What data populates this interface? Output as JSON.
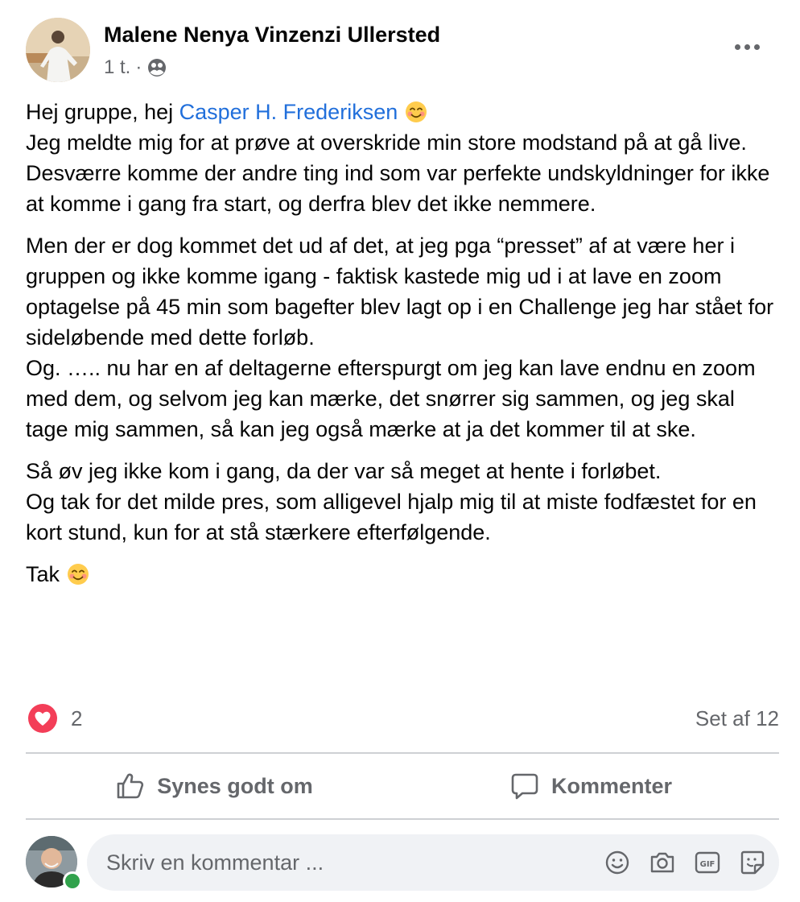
{
  "post": {
    "author_name": "Malene Nenya Vinzenzi Ullersted",
    "time": "1 t.",
    "separator": "·",
    "audience_icon": "group-icon",
    "paragraphs": [
      {
        "greeting_prefix": "Hej gruppe, hej ",
        "mention": "Casper H. Frederiksen",
        "emoji": "smiling-face-icon",
        "rest": "Jeg meldte mig for at prøve at overskride min store modstand på at gå live.\nDesværre komme der andre ting ind som var perfekte undskyldninger for ikke at komme i gang fra start, og derfra blev det ikke nemmere."
      },
      {
        "text": "Men der er dog kommet det ud af det, at jeg pga “presset” af at være her i gruppen og ikke komme igang - faktisk kastede mig ud i at lave en zoom optagelse på 45 min som bagefter blev lagt op i en Challenge jeg har stået for sideløbende med dette forløb.\nOg. ….. nu har en af deltagerne efterspurgt om jeg kan lave endnu en zoom med dem, og selvom jeg kan mærke, det snørrer sig sammen, og jeg skal tage mig sammen, så kan jeg også mærke at ja det kommer til at ske."
      },
      {
        "text": "Så øv jeg ikke kom i gang, da der var så meget at hente i forløbet.\nOg tak for det milde pres, som alligevel hjalp mig til at miste fodfæstet for en kort stund, kun for at stå stærkere efterfølgende."
      },
      {
        "text": "Tak",
        "emoji": "smiling-face-icon"
      }
    ]
  },
  "reactions": {
    "icon": "love-reaction-icon",
    "count": "2",
    "seen_by": "Set af 12"
  },
  "actions": {
    "like_label": "Synes godt om",
    "comment_label": "Kommenter"
  },
  "composer": {
    "placeholder": "Skriv en kommentar ...",
    "icons": [
      "emoji-icon",
      "camera-icon",
      "gif-icon",
      "sticker-icon"
    ]
  },
  "colors": {
    "mention": "#216fdb",
    "secondary_text": "#65676b",
    "love": "#f33e58",
    "online": "#31a24c"
  }
}
